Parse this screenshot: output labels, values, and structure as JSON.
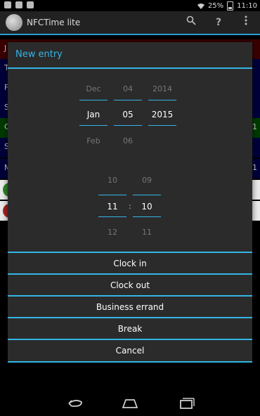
{
  "statusbar": {
    "battery": "25%",
    "time": "11:10"
  },
  "actionbar": {
    "title": "NFCTime lite",
    "search_icon": "search-icon",
    "help_icon": "help-icon",
    "overflow_icon": "overflow-icon"
  },
  "background_list": [
    {
      "char": "J",
      "num": "",
      "color": "#3a0000"
    },
    {
      "char": "T",
      "num": "",
      "color": "#00003a"
    },
    {
      "char": "F",
      "num": "",
      "color": "#00003a"
    },
    {
      "char": "S",
      "num": "",
      "color": "#00003a"
    },
    {
      "char": "C",
      "num": "1",
      "color": "#003a00"
    },
    {
      "char": "S",
      "num": "",
      "color": "#00003a"
    },
    {
      "char": "M",
      "num": "1",
      "color": "#00003a"
    }
  ],
  "dialog": {
    "title": "New entry",
    "date": {
      "month": {
        "prev": "Dec",
        "sel": "Jan",
        "next": "Feb"
      },
      "day": {
        "prev": "04",
        "sel": "05",
        "next": "06"
      },
      "year": {
        "prev": "2014",
        "sel": "2015",
        "next": ""
      }
    },
    "time": {
      "hour": {
        "prev": "10",
        "sel": "11",
        "next": "12"
      },
      "minute": {
        "prev": "09",
        "sel": "10",
        "next": "11"
      },
      "separator": ":"
    },
    "buttons": [
      "Clock in",
      "Clock out",
      "Business errand",
      "Break",
      "Cancel"
    ]
  },
  "colors": {
    "accent": "#33b5e5",
    "dialog_bg": "#2b2b2b"
  }
}
